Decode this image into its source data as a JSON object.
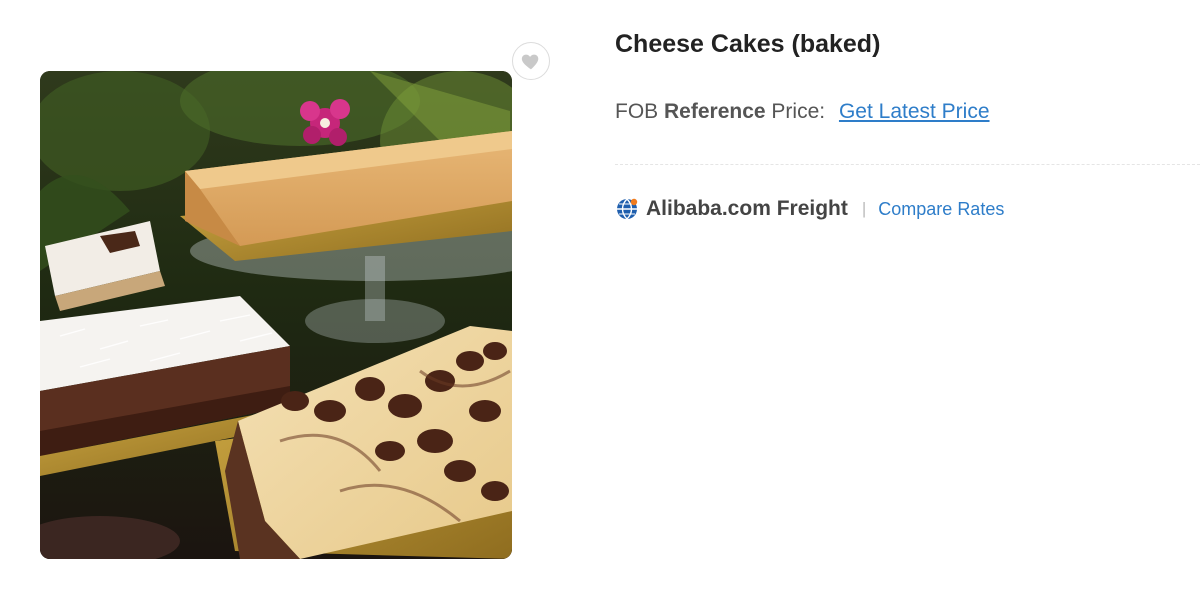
{
  "product": {
    "title": "Cheese Cakes (baked)",
    "image_alt": "cheese-cakes-photo"
  },
  "price": {
    "prefix": "FOB",
    "emphasis": "Reference",
    "suffix": "Price:",
    "link_label": "Get Latest Price"
  },
  "freight": {
    "icon": "globe-icon",
    "name": "Alibaba.com Freight",
    "separator": "|",
    "compare_label": "Compare Rates"
  },
  "colors": {
    "link": "#2e7dc9",
    "text": "#222222",
    "muted": "#555555"
  },
  "favorite": {
    "icon": "heart-icon"
  }
}
